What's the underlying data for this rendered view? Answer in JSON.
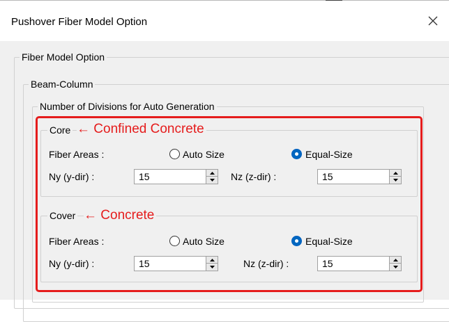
{
  "window": {
    "title": "Pushover Fiber Model Option",
    "close_icon": "close-icon"
  },
  "groups": {
    "fiber_model_option": "Fiber Model Option",
    "beam_column": "Beam-Column",
    "auto_generation": "Number of Divisions for Auto Generation"
  },
  "core": {
    "legend": "Core",
    "annotation": "← Confined Concrete",
    "fiber_areas_label": "Fiber Areas :",
    "auto_size_label": "Auto Size",
    "equal_size_label": "Equal-Size",
    "selected": "Equal-Size",
    "ny_label": "Ny (y-dir) :",
    "ny_value": "15",
    "nz_label": "Nz (z-dir) :",
    "nz_value": "15"
  },
  "cover": {
    "legend": "Cover",
    "annotation": "← Concrete",
    "fiber_areas_label": "Fiber Areas :",
    "auto_size_label": "Auto Size",
    "equal_size_label": "Equal-Size",
    "selected": "Equal-Size",
    "ny_label": "Ny (y-dir) :",
    "ny_value": "15",
    "nz_label": "Nz (z-dir) :",
    "nz_value": "15"
  },
  "colors": {
    "annotation_red": "#e51c1c",
    "radio_selected": "#0067c0",
    "dialog_background": "#f0f0f0"
  }
}
